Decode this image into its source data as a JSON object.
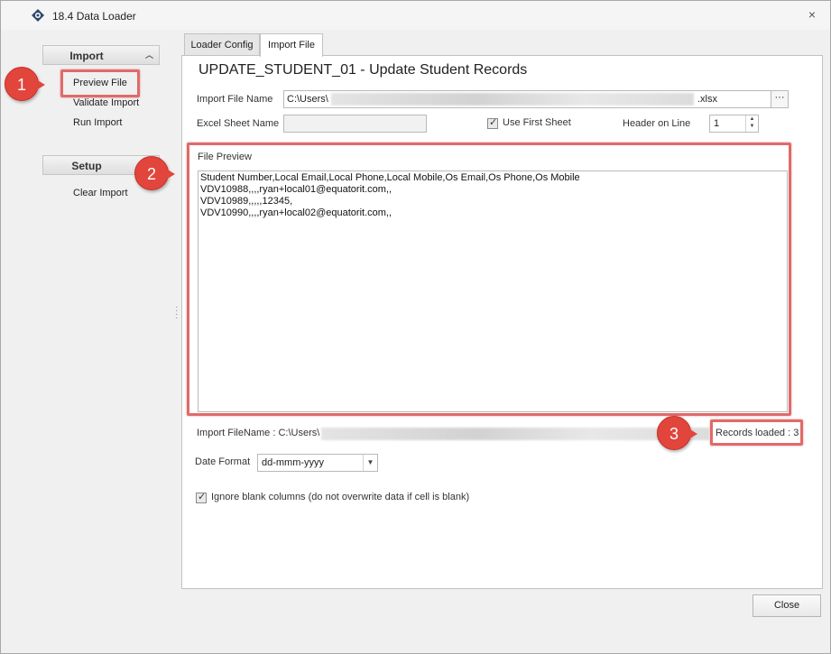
{
  "window": {
    "title": "18.4 Data Loader",
    "close_glyph": "×"
  },
  "sidebar": {
    "import_header": "Import",
    "import_items": [
      "Preview File",
      "Validate Import",
      "Run Import"
    ],
    "setup_header": "Setup",
    "setup_items": [
      "Clear Import"
    ]
  },
  "tabs": [
    "Loader Config",
    "Import File"
  ],
  "active_tab": "Import File",
  "main": {
    "record_title": "UPDATE_STUDENT_01 - Update Student Records",
    "import_file_label": "Import File Name",
    "import_file_prefix": "C:\\Users\\",
    "import_file_suffix": ".xlsx",
    "browse_label": "···",
    "excel_sheet_label": "Excel Sheet Name",
    "excel_sheet_value": "",
    "use_first_sheet_label": "Use First Sheet",
    "use_first_sheet_checked": true,
    "header_line_label": "Header on Line",
    "header_line_value": "1",
    "file_preview_label": "File Preview",
    "preview_lines": [
      "Student Number,Local Email,Local Phone,Local Mobile,Os Email,Os Phone,Os Mobile",
      "VDV10988,,,,ryan+local01@equatorit.com,,",
      "VDV10989,,,,,12345,",
      "VDV10990,,,,ryan+local02@equatorit.com,,"
    ],
    "import_filename_status": "Import FileName : C:\\Users\\",
    "records_loaded": "Records loaded : 3",
    "date_format_label": "Date Format",
    "date_format_value": "dd-mmm-yyyy",
    "ignore_blank_label": "Ignore blank columns (do not overwrite data if cell is blank)",
    "ignore_blank_checked": true
  },
  "footer": {
    "close_label": "Close"
  },
  "annotations": {
    "badge_1": "1",
    "badge_2": "2",
    "badge_3": "3",
    "highlight_color": "#e06a6a",
    "badge_color": "#e1453c"
  }
}
